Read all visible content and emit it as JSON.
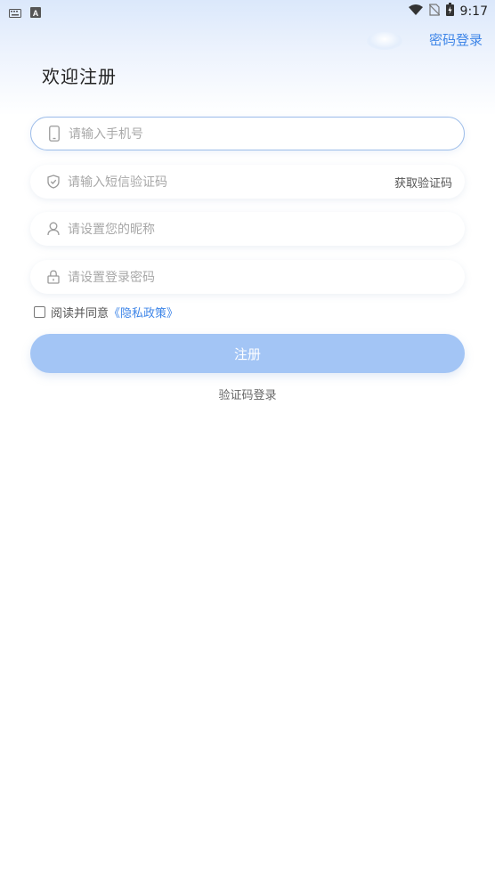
{
  "status_bar": {
    "time": "9:17",
    "icons": [
      "keyboard-icon",
      "font-a-icon",
      "wifi-icon",
      "no-sim-icon",
      "battery-icon"
    ]
  },
  "header": {
    "password_login": "密码登录",
    "title": "欢迎注册"
  },
  "form": {
    "phone_placeholder": "请输入手机号",
    "sms_placeholder": "请输入短信验证码",
    "get_code": "获取验证码",
    "nickname_placeholder": "请设置您的昵称",
    "password_placeholder": "请设置登录密码"
  },
  "agreement": {
    "text": "阅读并同意",
    "link": "《隐私政策》",
    "checked": false
  },
  "actions": {
    "register": "注册",
    "code_login": "验证码登录"
  },
  "colors": {
    "accent": "#3f86e8",
    "button_disabled": "#a3c5f5",
    "placeholder": "#a8a8a8"
  }
}
